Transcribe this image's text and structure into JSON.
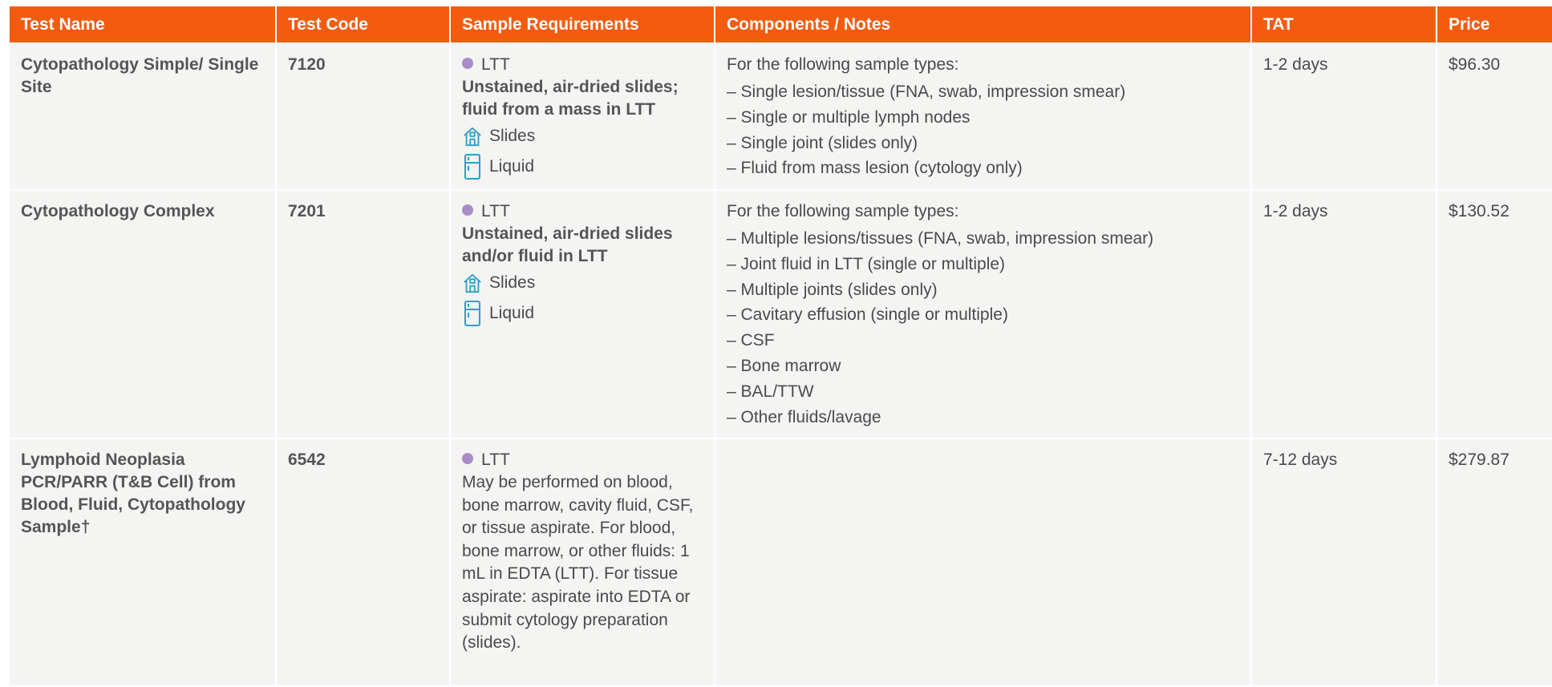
{
  "headers": {
    "test_name": "Test Name",
    "test_code": "Test Code",
    "sample_requirements": "Sample Requirements",
    "components_notes": "Components / Notes",
    "tat": "TAT",
    "price": "Price"
  },
  "colors": {
    "header_bg": "#f35c0f",
    "cell_bg": "#f4f4f3",
    "dot": "#a98bc8",
    "icon": "#2e9ec9"
  },
  "rows": [
    {
      "name": "Cytopathology Simple/ Single Site",
      "code": "7120",
      "tube": "LTT",
      "requirement_bold": "Unstained, air-dried slides; fluid from a mass in LTT",
      "storage": [
        {
          "icon": "room-temperature-icon",
          "label": "Slides"
        },
        {
          "icon": "refrigerator-icon",
          "label": "Liquid"
        }
      ],
      "notes_intro": "For the following sample types:",
      "notes": [
        "Single lesion/tissue (FNA, swab, impression smear)",
        "Single or multiple lymph nodes",
        "Single joint (slides only)",
        "Fluid from mass lesion (cytology only)"
      ],
      "tat": "1-2 days",
      "price": "$96.30"
    },
    {
      "name": "Cytopathology Complex",
      "code": "7201",
      "tube": "LTT",
      "requirement_bold": "Unstained, air-dried slides and/or fluid in LTT",
      "storage": [
        {
          "icon": "room-temperature-icon",
          "label": "Slides"
        },
        {
          "icon": "refrigerator-icon",
          "label": "Liquid"
        }
      ],
      "notes_intro": "For the following sample types:",
      "notes": [
        "Multiple lesions/tissues (FNA, swab, impression smear)",
        "Joint fluid in LTT (single or multiple)",
        "Multiple joints (slides only)",
        "Cavitary effusion (single or multiple)",
        "CSF",
        "Bone marrow",
        "BAL/TTW",
        "Other fluids/lavage"
      ],
      "tat": "1-2 days",
      "price": "$130.52"
    },
    {
      "name": "Lymphoid Neoplasia PCR/PARR (T&B Cell) from Blood, Fluid, Cytopathology Sample†",
      "code": "6542",
      "tube": "LTT",
      "requirement_plain": "May be performed on blood, bone marrow, cavity fluid, CSF, or tissue aspirate. For blood, bone marrow, or other fluids: 1 mL in EDTA (LTT). For tissue aspirate: aspirate into EDTA or submit cytology preparation (slides).",
      "tat": "7-12 days",
      "price": "$279.87"
    }
  ]
}
